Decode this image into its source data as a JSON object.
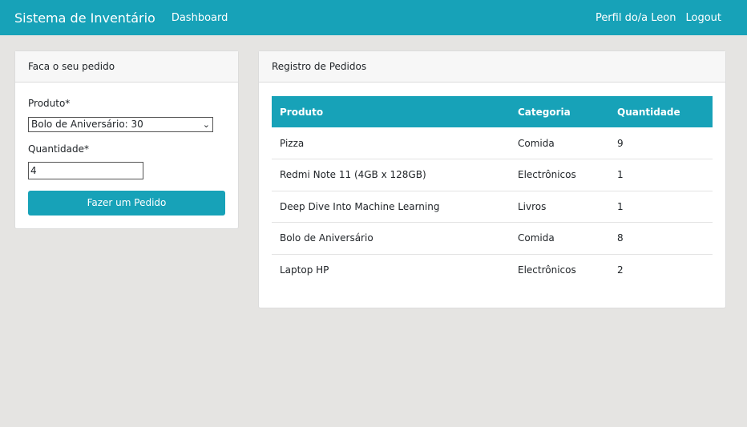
{
  "navbar": {
    "brand": "Sistema de Inventário",
    "dashboard": "Dashboard",
    "profile": "Perfil do/a Leon",
    "logout": "Logout"
  },
  "order_form": {
    "title": "Faca o seu pedido",
    "product_label": "Produto*",
    "product_selected": "Bolo de Aniversário: 30",
    "quantity_label": "Quantidade*",
    "quantity_value": "4",
    "submit": "Fazer um Pedido"
  },
  "orders": {
    "title": "Registro de Pedidos",
    "columns": [
      "Produto",
      "Categoria",
      "Quantidade"
    ],
    "rows": [
      [
        "Pizza",
        "Comida",
        "9"
      ],
      [
        "Redmi Note 11 (4GB x 128GB)",
        "Electrônicos",
        "1"
      ],
      [
        "Deep Dive Into Machine Learning",
        "Livros",
        "1"
      ],
      [
        "Bolo de Aniversário",
        "Comida",
        "8"
      ],
      [
        "Laptop HP",
        "Electrônicos",
        "2"
      ]
    ]
  },
  "colors": {
    "accent": "#17a2b8",
    "background": "#e5e4e2"
  },
  "icons": {
    "select_arrow": "chevron-down-icon"
  }
}
